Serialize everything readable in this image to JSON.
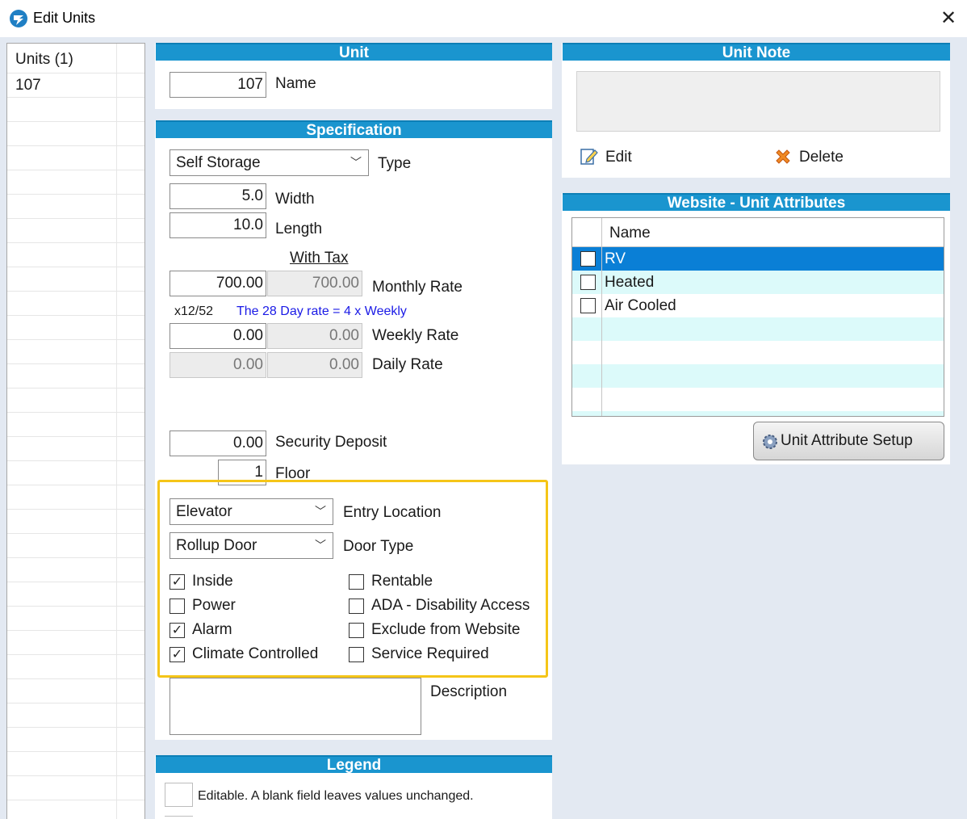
{
  "window": {
    "title": "Edit Units",
    "close": "✕"
  },
  "unit_list": {
    "header": "Units (1)",
    "items": [
      "107"
    ]
  },
  "unit": {
    "header": "Unit",
    "name_value": "107",
    "name_label": "Name"
  },
  "specification": {
    "header": "Specification",
    "type_value": "Self Storage",
    "type_label": "Type",
    "width_value": "5.0",
    "width_label": "Width",
    "length_value": "10.0",
    "length_label": "Length",
    "with_tax_label": "With Tax",
    "monthly_value": "700.00",
    "monthly_tax_value": "700.00",
    "monthly_label": "Monthly Rate",
    "multiplier_note": "x12/52",
    "rate_note": "The 28 Day rate = 4 x Weekly",
    "weekly_value": "0.00",
    "weekly_tax_value": "0.00",
    "weekly_label": "Weekly Rate",
    "daily_value": "0.00",
    "daily_tax_value": "0.00",
    "daily_label": "Daily Rate",
    "deposit_value": "0.00",
    "deposit_label": "Security Deposit",
    "floor_value": "1",
    "floor_label": "Floor",
    "entry_value": "Elevator",
    "entry_label": "Entry Location",
    "door_value": "Rollup Door",
    "door_label": "Door Type",
    "checkboxes_left": [
      {
        "label": "Inside",
        "checked": true
      },
      {
        "label": "Power",
        "checked": false
      },
      {
        "label": "Alarm",
        "checked": true
      },
      {
        "label": "Climate Controlled",
        "checked": true
      }
    ],
    "checkboxes_right": [
      {
        "label": "Rentable",
        "checked": false
      },
      {
        "label": "ADA - Disability Access",
        "checked": false
      },
      {
        "label": "Exclude from Website",
        "checked": false
      },
      {
        "label": "Service Required",
        "checked": false
      }
    ],
    "description_label": "Description",
    "description_value": ""
  },
  "legend": {
    "header": "Legend",
    "editable_text": "Editable.  A blank field leaves values unchanged."
  },
  "unit_note": {
    "header": "Unit Note",
    "edit_label": "Edit",
    "delete_label": "Delete"
  },
  "website_attributes": {
    "header": "Website - Unit Attributes",
    "column_name": "Name",
    "items": [
      {
        "label": "RV",
        "checked": false,
        "selected": true
      },
      {
        "label": "Heated",
        "checked": false,
        "selected": false
      },
      {
        "label": "Air Cooled",
        "checked": false,
        "selected": false
      }
    ],
    "setup_button": "Unit Attribute Setup"
  },
  "colors": {
    "header_blue": "#1a95cf",
    "selected_row": "#0a7fd6",
    "alt_row": "#dcfafa",
    "highlight": "#f5c518"
  }
}
